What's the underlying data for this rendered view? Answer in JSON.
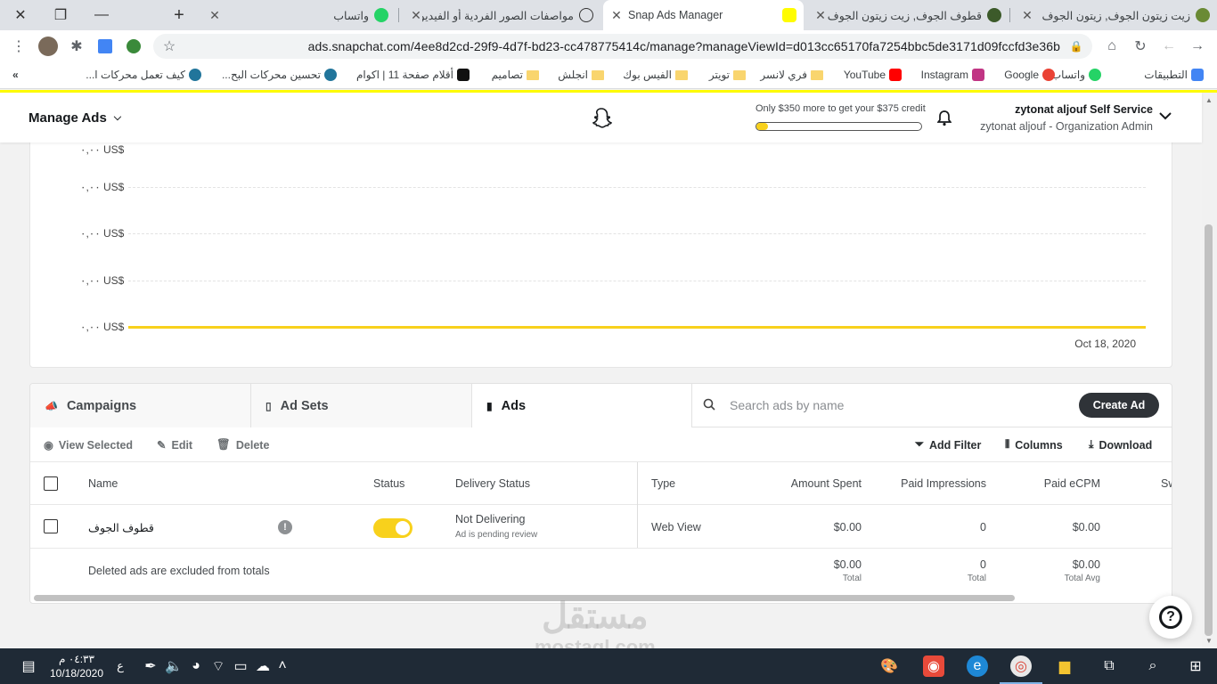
{
  "browser": {
    "tabs": [
      {
        "title": "زيت زيتون الجوف, زيتون الجوف",
        "active": false
      },
      {
        "title": "قطوف الجوف, زيت زيتون الجوف",
        "active": false
      },
      {
        "title": "Snap Ads Manager",
        "active": true
      },
      {
        "title": "مواصفات الصور الفردية أو الفيديو",
        "active": false
      },
      {
        "title": "واتساب",
        "active": false
      }
    ],
    "url": "ads.snapchat.com/4ee8d2cd-29f9-4d7f-bd23-cc478775414c/manage?manageViewId=d013cc65170fa7254bbc5de3171d09fccfd3e36b",
    "bookmarks": [
      {
        "label": "التطبيقات",
        "icon": "apps-icon",
        "color": "#4285f4"
      },
      {
        "label": "واتساب",
        "icon": "whatsapp-icon",
        "color": "#25d366"
      },
      {
        "label": "Google",
        "icon": "google-icon",
        "color": "#ea4335"
      },
      {
        "label": "Instagram",
        "icon": "instagram-icon",
        "color": "#c13584"
      },
      {
        "label": "YouTube",
        "icon": "youtube-icon",
        "color": "#ff0000"
      },
      {
        "label": "فري لانسر",
        "icon": "folder-icon",
        "color": "#f9d56e"
      },
      {
        "label": "تويتر",
        "icon": "folder-icon",
        "color": "#f9d56e"
      },
      {
        "label": "الفيس بوك",
        "icon": "folder-icon",
        "color": "#f9d56e"
      },
      {
        "label": "انجلش",
        "icon": "folder-icon",
        "color": "#f9d56e"
      },
      {
        "label": "تصاميم",
        "icon": "folder-icon",
        "color": "#f9d56e"
      },
      {
        "label": "أقلام صفحة 11 | اكوام",
        "icon": "akwam-icon",
        "color": "#111111"
      },
      {
        "label": "تحسين محركات البح...",
        "icon": "wordpress-icon",
        "color": "#21759b"
      },
      {
        "label": "كيف تعمل محركات ا...",
        "icon": "wordpress-icon",
        "color": "#21759b"
      }
    ]
  },
  "header": {
    "manage_label": "Manage Ads",
    "credit_text": "Only $350 more to get your $375 credit",
    "credit_progress": 0.07,
    "account_name": "zytonat aljouf Self Service",
    "account_sub": "zytonat aljouf - Organization Admin"
  },
  "chart_data": {
    "type": "line",
    "x": [
      "Oct 18, 2020"
    ],
    "series": [
      {
        "values": [
          0
        ]
      }
    ],
    "y_tick_labels": [
      "٠,٠٠ US$",
      "٠,٠٠ US$",
      "٠,٠٠ US$",
      "٠,٠٠ US$",
      "٠,٠٠ US$"
    ],
    "x_tick_label": "Oct 18, 2020",
    "grid": true,
    "series_color": "#f8d11c"
  },
  "tabs": {
    "campaigns": "Campaigns",
    "ad_sets": "Ad Sets",
    "ads": "Ads",
    "search_placeholder": "Search ads by name",
    "create": "Create Ad"
  },
  "actions": {
    "view_selected": "View Selected",
    "edit": "Edit",
    "delete": "Delete",
    "add_filter": "Add Filter",
    "columns": "Columns",
    "download": "Download"
  },
  "table": {
    "headers": {
      "name": "Name",
      "status": "Status",
      "delivery": "Delivery Status",
      "type": "Type",
      "spent": "Amount Spent",
      "impressions": "Paid Impressions",
      "ecpm": "Paid eCPM",
      "swipes": "Sw"
    },
    "rows": [
      {
        "name": "قطوف الجوف",
        "status_on": true,
        "delivery": "Not Delivering",
        "delivery_sub": "Ad is pending review",
        "type": "Web View",
        "spent": "$0.00",
        "impressions": "0",
        "ecpm": "$0.00"
      }
    ],
    "totals": {
      "note": "Deleted ads are excluded from totals",
      "spent": "$0.00",
      "spent_label": "Total",
      "impressions": "0",
      "impressions_label": "Total",
      "ecpm": "$0.00",
      "ecpm_label": "Total Avg"
    }
  },
  "watermark": {
    "arabic": "مستقل",
    "latin": "mostaql.com"
  },
  "taskbar": {
    "time": "٠٤:٣٣ م",
    "date": "10/18/2020",
    "lang": "ع"
  }
}
